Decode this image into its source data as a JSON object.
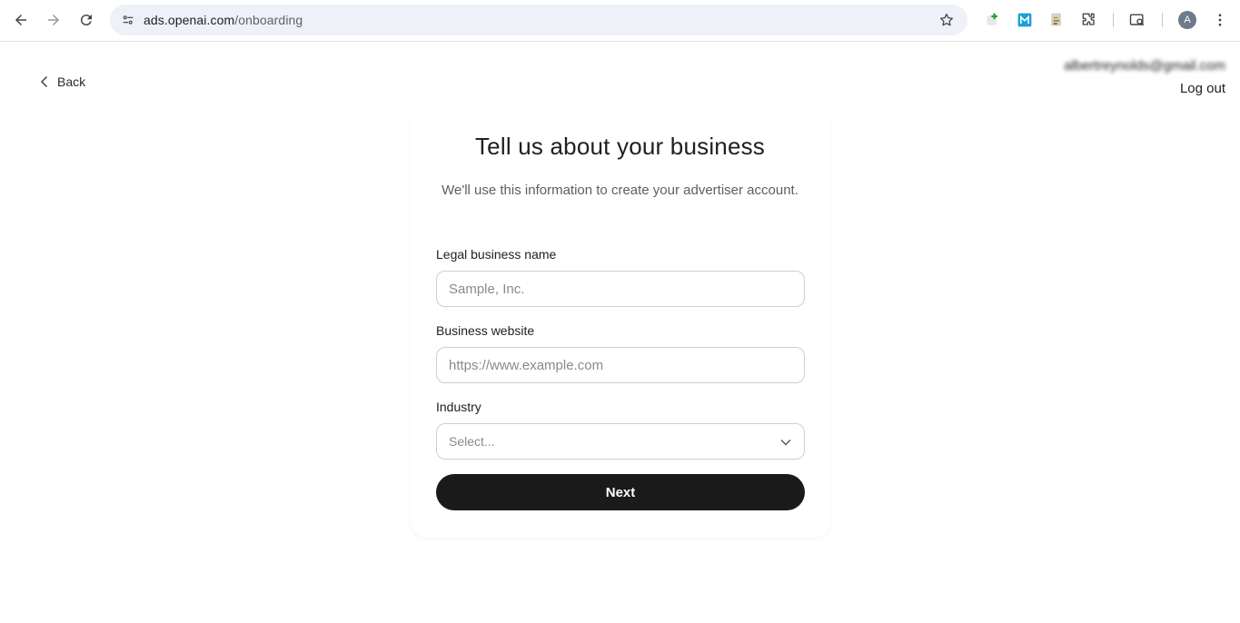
{
  "browser": {
    "url_host": "ads.openai.com",
    "url_path": "/onboarding",
    "profile_initial": "A",
    "extensions": [
      "plus-extension-icon",
      "m-extension-icon",
      "document-extension-icon",
      "puzzle-icon"
    ]
  },
  "header": {
    "back_label": "Back",
    "email": "albertreynolds@gmail.com",
    "logout_label": "Log out"
  },
  "form": {
    "title": "Tell us about your business",
    "subtitle": "We'll use this information to create your advertiser account.",
    "business_name": {
      "label": "Legal business name",
      "value": "",
      "placeholder": "Sample, Inc."
    },
    "website": {
      "label": "Business website",
      "value": "",
      "placeholder": "https://www.example.com"
    },
    "industry": {
      "label": "Industry",
      "selected": "Select..."
    },
    "next_label": "Next"
  },
  "colors": {
    "primary_button": "#1a1a1a",
    "omnibox_bg": "#eef1f8",
    "border": "#cfcfcf"
  }
}
